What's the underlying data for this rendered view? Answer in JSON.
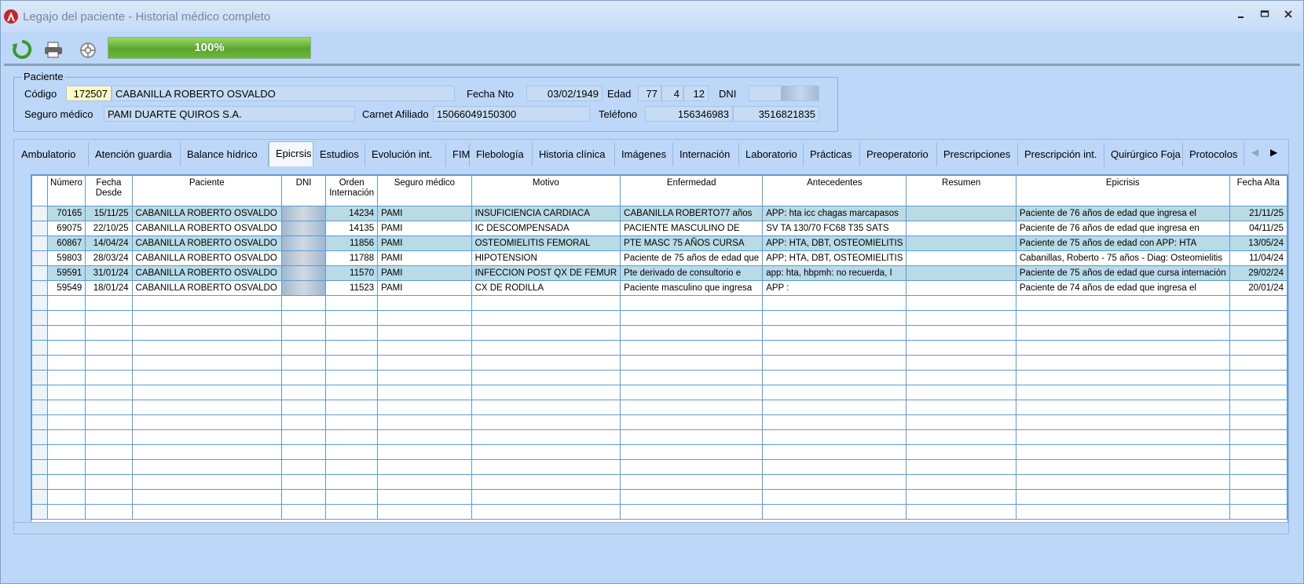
{
  "window": {
    "title": "Legajo del paciente - Historial médico completo"
  },
  "toolbar": {
    "progress": "100%",
    "progress_value": 100
  },
  "patient": {
    "group_label": "Paciente",
    "codigo_label": "Código",
    "codigo": "172507",
    "nombre": "CABANILLA ROBERTO OSVALDO",
    "fecha_nto_label": "Fecha Nto",
    "fecha_nto": "03/02/1949",
    "edad_label": "Edad",
    "edad_anios": "77",
    "edad_meses": "4",
    "edad_dias": "12",
    "dni_label": "DNI",
    "seguro_label": "Seguro médico",
    "seguro": "PAMI DUARTE QUIROS S.A.",
    "carnet_label": "Carnet Afiliado",
    "carnet": "15066049150300",
    "telefono_label": "Teléfono",
    "telefono1": "156346983",
    "telefono2": "3516821835"
  },
  "tabs": [
    "Ambulatorio",
    "Atención guardia",
    "Balance hídrico",
    "Epicrsis",
    "Estudios",
    "Evolución int.",
    "FIM",
    "Flebología",
    "Historia clínica",
    "Imágenes",
    "Internación",
    "Laboratorio",
    "Prácticas",
    "Preoperatorio",
    "Prescripciones",
    "Prescripción int.",
    "Quirúrgico Foja",
    "Protocolos"
  ],
  "active_tab": "Epicrsis",
  "grid": {
    "headers": [
      "Número",
      "Fecha Desde",
      "Paciente",
      "DNI",
      "Orden Internación",
      "Seguro médico",
      "Motivo",
      "Enfermedad",
      "Antecedentes",
      "Resumen",
      "Epicrisis",
      "Fecha Alta"
    ],
    "rows": [
      [
        "70165",
        "15/11/25",
        "CABANILLA ROBERTO OSVALDO",
        "",
        "14234",
        "PAMI",
        "INSUFICIENCIA CARDIACA",
        "CABANILLA ROBERTO77 años",
        "APP: hta icc chagas marcapasos",
        "",
        "Paciente de 76 años de edad que ingresa el",
        "21/11/25"
      ],
      [
        "69075",
        "22/10/25",
        "CABANILLA ROBERTO OSVALDO",
        "",
        "14135",
        "PAMI",
        "IC DESCOMPENSADA",
        "PACIENTE MASCULINO DE",
        "SV TA 130/70 FC68 T35 SATS",
        "",
        "Paciente de 76 años de edad que ingresa en",
        "04/11/25"
      ],
      [
        "60867",
        "14/04/24",
        "CABANILLA ROBERTO OSVALDO",
        "",
        "11856",
        "PAMI",
        "OSTEOMIELITIS FEMORAL",
        "PTE MASC 75 AÑOS CURSA",
        "APP: HTA, DBT, OSTEOMIELITIS",
        "",
        "Paciente de 75 años de edad con APP: HTA",
        "13/05/24"
      ],
      [
        "59803",
        "28/03/24",
        "CABANILLA ROBERTO OSVALDO",
        "",
        "11788",
        "PAMI",
        "HIPOTENSION",
        "Paciente de 75 años de edad que",
        "APP; HTA, DBT, OSTEOMIELITIS",
        "",
        "Cabanillas, Roberto - 75 años - Diag: Osteomielitis",
        "11/04/24"
      ],
      [
        "59591",
        "31/01/24",
        "CABANILLA ROBERTO OSVALDO",
        "",
        "11570",
        "PAMI",
        "INFECCION POST QX DE FEMUR",
        "Pte derivado de consultorio e",
        "app: hta, hbpmh: no recuerda, I",
        "",
        "Paciente de 75 años de edad que cursa internación",
        "29/02/24"
      ],
      [
        "59549",
        "18/01/24",
        "CABANILLA ROBERTO OSVALDO",
        "",
        "11523",
        "PAMI",
        "CX DE RODILLA",
        "Paciente masculino que ingresa",
        "APP :",
        "",
        "Paciente de 74 años de edad que ingresa el",
        "20/01/24"
      ]
    ]
  },
  "colors": {
    "window_bg": "#bdd7f8",
    "row_alt": "#b8dbe6",
    "grid_line": "#5b9bd5",
    "progress": "#6cb83c"
  }
}
